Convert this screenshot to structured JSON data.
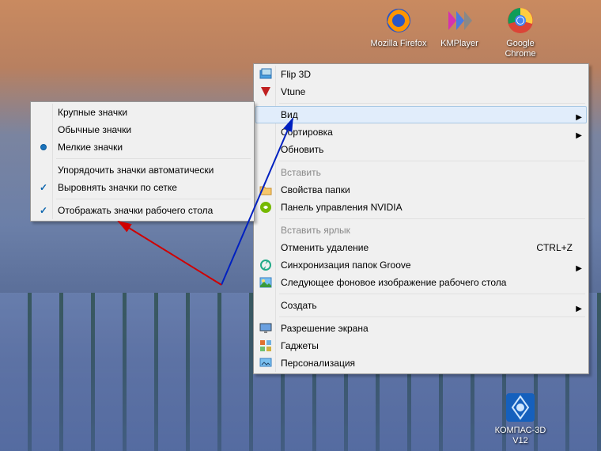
{
  "desktop_icons": {
    "firefox": "Mozilla Firefox",
    "kmplayer": "KMPlayer",
    "chrome": "Google Chrome",
    "kompas": "КОМПАС-3D V12"
  },
  "submenu": {
    "large": "Крупные значки",
    "medium": "Обычные значки",
    "small": "Мелкие значки",
    "auto": "Упорядочить значки автоматически",
    "grid": "Выровнять значки по сетке",
    "show": "Отображать значки рабочего стола"
  },
  "menu": {
    "flip3d": "Flip 3D",
    "vtune": "Vtune",
    "view": "Вид",
    "sort": "Сортировка",
    "refresh": "Обновить",
    "paste": "Вставить",
    "folderprops": "Свойства папки",
    "nvidia": "Панель управления NVIDIA",
    "pasteshort": "Вставить ярлык",
    "undo": "Отменить удаление",
    "undo_key": "CTRL+Z",
    "groove": "Синхронизация папок Groove",
    "nextbg": "Следующее фоновое изображение рабочего стола",
    "create": "Создать",
    "res": "Разрешение экрана",
    "gadgets": "Гаджеты",
    "personal": "Персонализация"
  }
}
